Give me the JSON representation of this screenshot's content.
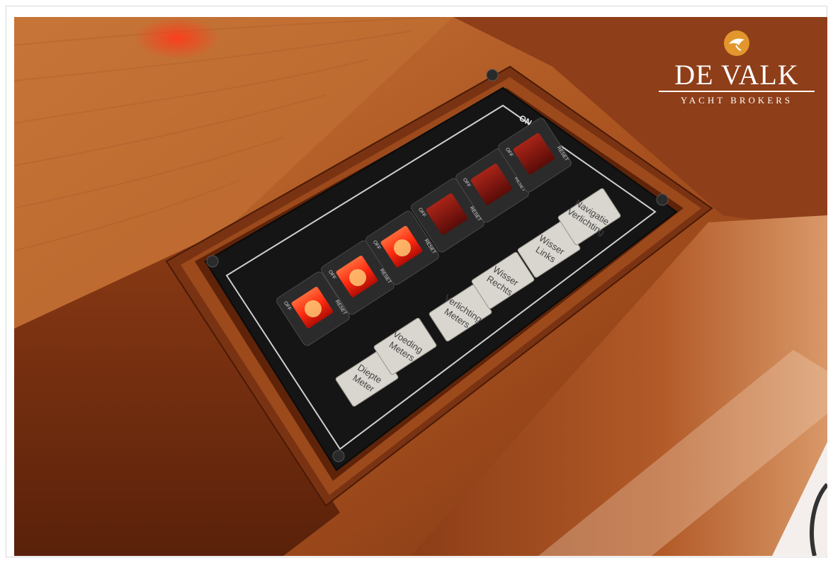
{
  "logo": {
    "name": "DE VALK",
    "subtitle": "YACHT BROKERS",
    "icon": "hawk-emblem-icon",
    "accent": "#e3962c"
  },
  "panel": {
    "direction_label": "ON",
    "switch_top_label": "OFF",
    "switch_bottom_label": "RESET",
    "switches": [
      {
        "label_line1": "Diepte",
        "label_line2": "Meter",
        "state": "lit"
      },
      {
        "label_line1": "Voeding",
        "label_line2": "Meters",
        "state": "lit"
      },
      {
        "label_line1": "Verlichting",
        "label_line2": "Meters",
        "state": "lit"
      },
      {
        "label_line1": "Wisser",
        "label_line2": "Rechts",
        "state": "dark"
      },
      {
        "label_line1": "Wisser",
        "label_line2": "Links",
        "state": "dark"
      },
      {
        "label_line1": "Navigatie",
        "label_line2": "Verlichting",
        "state": "dark"
      }
    ]
  },
  "colors": {
    "wood_dark": "#6b2a0e",
    "wood_mid": "#9a4a1e",
    "wood_light": "#c06a32",
    "lit_red": "#ff2a10",
    "panel": "#141414"
  }
}
